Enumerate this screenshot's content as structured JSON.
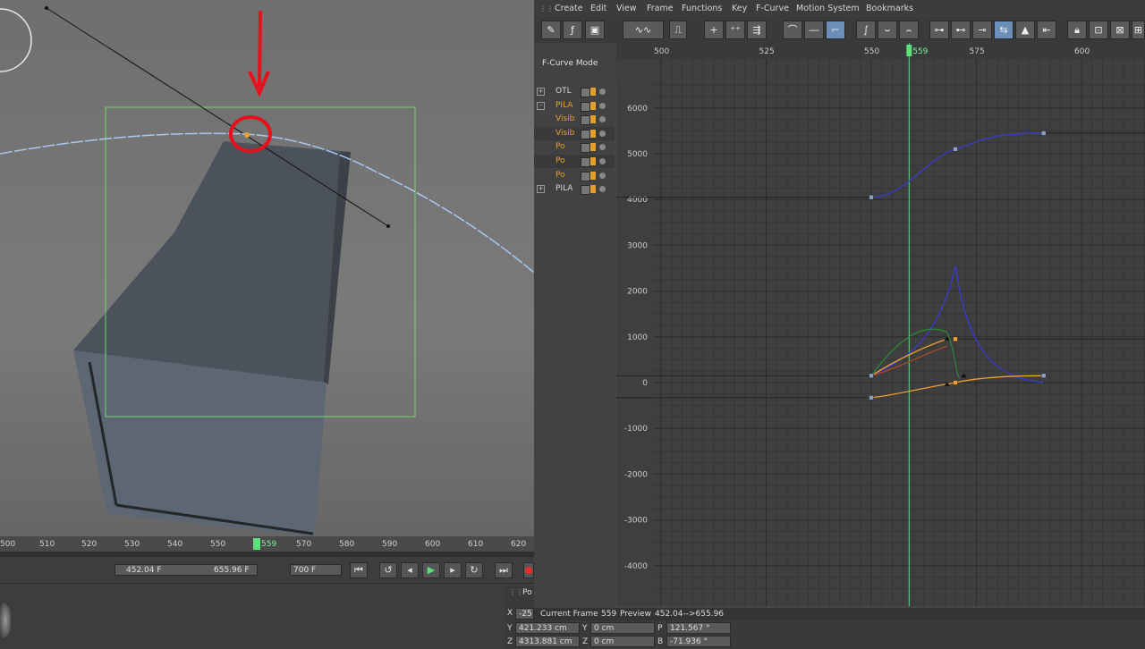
{
  "menu": [
    "Create",
    "Edit",
    "View",
    "Frame",
    "Functions",
    "Key",
    "F-Curve",
    "Motion System",
    "Bookmarks"
  ],
  "mode_label": "F-Curve Mode",
  "tree": [
    {
      "name": "OTL",
      "color": "#d6d6d6",
      "expander": "+"
    },
    {
      "name": "PILA",
      "color": "#e8a030",
      "expander": "-"
    },
    {
      "name": "Visib",
      "color": "#e8a030",
      "expander": ""
    },
    {
      "name": "Visib",
      "color": "#e8a030",
      "expander": ""
    },
    {
      "name": "Po",
      "color": "#e8a030",
      "expander": ""
    },
    {
      "name": "Po",
      "color": "#e8a030",
      "expander": ""
    },
    {
      "name": "Po",
      "color": "#e8a030",
      "expander": ""
    },
    {
      "name": "PILA",
      "color": "#d6d6d6",
      "expander": "+"
    }
  ],
  "frame_ruler": [
    "500",
    "525",
    "550",
    "575",
    "600"
  ],
  "current_frame_marker": "559",
  "value_axis": [
    "6000",
    "5000",
    "4000",
    "3000",
    "2000",
    "1000",
    "0",
    "-1000",
    "-2000",
    "-3000",
    "-4000"
  ],
  "timeline": {
    "ticks": [
      "500",
      "510",
      "520",
      "530",
      "540",
      "550",
      "559",
      "570",
      "580",
      "590",
      "600",
      "610",
      "620"
    ],
    "range_start": "452.04 F",
    "range_end": "655.96 F",
    "end_frame": "700 F"
  },
  "status": {
    "current_frame_label": "Current Frame",
    "current_frame": "559",
    "preview_label": "Preview",
    "preview_range": "452.04-->655.96"
  },
  "coords_header": "Po",
  "coords": {
    "x_label": "X",
    "x_value": "-25",
    "y_label": "Y",
    "y_value": "421.233 cm",
    "z_label": "Z",
    "z_value": "4313.881 cm",
    "y2_label": "Y",
    "y2_value": "0 cm",
    "z2_label": "Z",
    "z2_value": "0 cm",
    "p_label": "P",
    "p_value": "121.567 °",
    "b_label": "B",
    "b_value": "-71.936 °"
  },
  "colors": {
    "accent_green": "#5ce07a",
    "curve_blue": "#3a3ad0",
    "curve_orange": "#f0a030",
    "bbox_green": "#6ed86e"
  }
}
